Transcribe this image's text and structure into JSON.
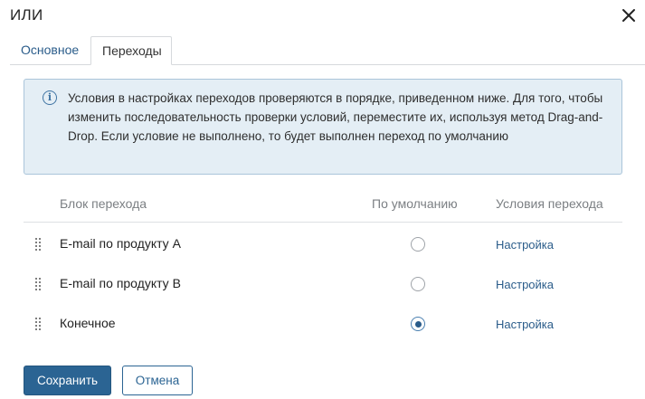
{
  "dialog": {
    "title": "ИЛИ",
    "close_icon": "close-icon"
  },
  "tabs": [
    {
      "label": "Основное",
      "active": false
    },
    {
      "label": "Переходы",
      "active": true
    }
  ],
  "info": {
    "icon": "info-icon",
    "text": "Условия в настройках переходов проверяются в порядке, приведенном ниже. Для того, чтобы изменить последовательность проверки условий, переместите их, используя метод Drag-and-Drop. Если условие не выполнено, то будет выполнен переход по умолчанию"
  },
  "table": {
    "headers": {
      "block": "Блок перехода",
      "default": "По умолчанию",
      "conditions": "Условия перехода"
    },
    "rows": [
      {
        "name": "E-mail по продукту A",
        "default": false,
        "link": "Настройка"
      },
      {
        "name": "E-mail по продукту B",
        "default": false,
        "link": "Настройка"
      },
      {
        "name": "Конечное",
        "default": true,
        "link": "Настройка"
      }
    ]
  },
  "buttons": {
    "save": "Сохранить",
    "cancel": "Отмена"
  },
  "colors": {
    "accent": "#2b6493",
    "link": "#2a5c8a",
    "info_bg": "#e4eef5",
    "info_border": "#aac5da"
  }
}
